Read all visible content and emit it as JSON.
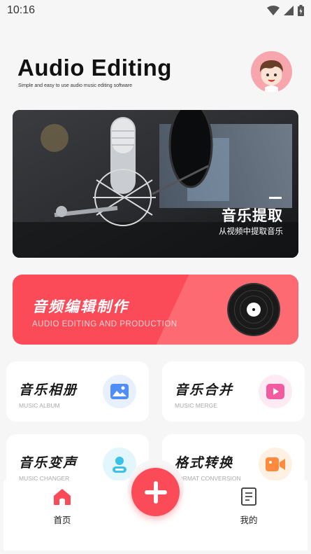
{
  "status_bar": {
    "time": "10:16"
  },
  "header": {
    "title": "Audio Editing",
    "subtitle": "Simple and easy to use audio music editing software",
    "avatar_icon": "cartoon-avatar-icon"
  },
  "banner": {
    "title": "音乐提取",
    "subtitle": "从视频中提取音乐",
    "image": "studio-microphone"
  },
  "red_card": {
    "title": "音频编辑制作",
    "subtitle": "AUDIO EDITING AND PRODUCTION",
    "icon": "vinyl-record-icon",
    "color": "#fb4a58"
  },
  "features": [
    {
      "title": "音乐相册",
      "subtitle": "MUSIC ALBUM",
      "icon": "image-icon",
      "color": "#4f8df7"
    },
    {
      "title": "音乐合并",
      "subtitle": "MUSIC MERGE",
      "icon": "play-icon",
      "color": "#f35ba1"
    },
    {
      "title": "音乐变声",
      "subtitle": "MUSIC CHANGER",
      "icon": "user-icon",
      "color": "#3cc2e6"
    },
    {
      "title": "格式转换",
      "subtitle": "FORMAT CONVERSION",
      "icon": "video-icon",
      "color": "#ff8a3d"
    }
  ],
  "bottom_nav": {
    "home_label": "首页",
    "mine_label": "我的",
    "add_icon": "plus-icon"
  }
}
